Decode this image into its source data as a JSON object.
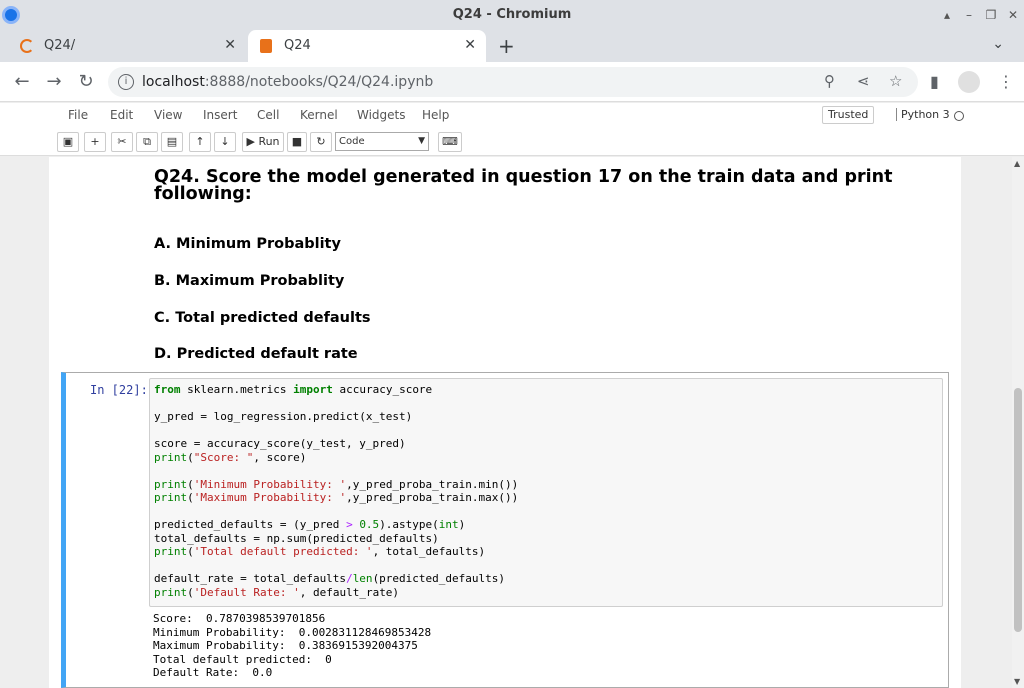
{
  "window": {
    "title": "Q24 - Chromium"
  },
  "tabs": [
    {
      "label": "Q24/"
    },
    {
      "label": "Q24"
    }
  ],
  "omnibox": {
    "host": "localhost",
    "path": ":8888/notebooks/Q24/Q24.ipynb"
  },
  "jupyter_menu": [
    "File",
    "Edit",
    "View",
    "Insert",
    "Cell",
    "Kernel",
    "Widgets",
    "Help"
  ],
  "trusted_label": "Trusted",
  "kernel_name": "Python 3",
  "toolbar": {
    "run_label": "Run",
    "cell_type": "Code"
  },
  "markdown": {
    "title": "Q24. Score the model generated in question 17 on the train data and print following:",
    "items": [
      "A. Minimum Probablity",
      "B. Maximum Probablity",
      "C. Total predicted defaults",
      "D. Predicted default rate"
    ]
  },
  "code_cell": {
    "prompt": "In [22]:",
    "lines": [
      [
        [
          "kw",
          "from"
        ],
        [
          "",
          "  sklearn.metrics "
        ],
        [
          "kw",
          "import"
        ],
        [
          "",
          " accuracy_score"
        ]
      ],
      [],
      [
        [
          "",
          "y_pred = log_regression.predict(x_test)"
        ]
      ],
      [],
      [
        [
          "",
          "score = accuracy_score(y_test, y_pred)"
        ]
      ],
      [
        [
          "fn-print",
          "print"
        ],
        [
          "",
          "("
        ],
        [
          "str",
          "\"Score: \""
        ],
        [
          "",
          ", score)"
        ]
      ],
      [],
      [
        [
          "fn-print",
          "print"
        ],
        [
          "",
          "("
        ],
        [
          "str",
          "'Minimum Probability: '"
        ],
        [
          "",
          ",y_pred_proba_train.min())"
        ]
      ],
      [
        [
          "fn-print",
          "print"
        ],
        [
          "",
          "("
        ],
        [
          "str",
          "'Maximum Probability: '"
        ],
        [
          "",
          ",y_pred_proba_train.max())"
        ]
      ],
      [],
      [
        [
          "",
          "predicted_defaults = (y_pred "
        ],
        [
          "op",
          ">"
        ],
        [
          "",
          " "
        ],
        [
          "bi",
          "0.5"
        ],
        [
          "",
          "). astype("
        ],
        [
          "bi",
          "int"
        ],
        [
          "",
          ")"
        ]
      ],
      [
        [
          "",
          "total_defaults = np.sum(predicted_defaults)"
        ]
      ],
      [
        [
          "fn-print",
          "print"
        ],
        [
          "",
          "("
        ],
        [
          "str",
          "'Total default predicted: '"
        ],
        [
          "",
          ", total_defaults)"
        ]
      ],
      [],
      [
        [
          "",
          "default_rate = total_defaults"
        ],
        [
          "op",
          "/"
        ],
        [
          "bi",
          "len"
        ],
        [
          "",
          "(predicted_defaults)"
        ]
      ],
      [
        [
          "fn-print",
          "print"
        ],
        [
          "",
          "("
        ],
        [
          "str",
          "'Default Rate: '"
        ],
        [
          "",
          ", default_rate)"
        ]
      ]
    ],
    "output": [
      "Score:  0.7870398539701856",
      "Minimum Probability:  0.002831128469853428",
      "Maximum Probability:  0.3836915392004375",
      "Total default predicted:  0",
      "Default Rate:  0.0"
    ]
  }
}
